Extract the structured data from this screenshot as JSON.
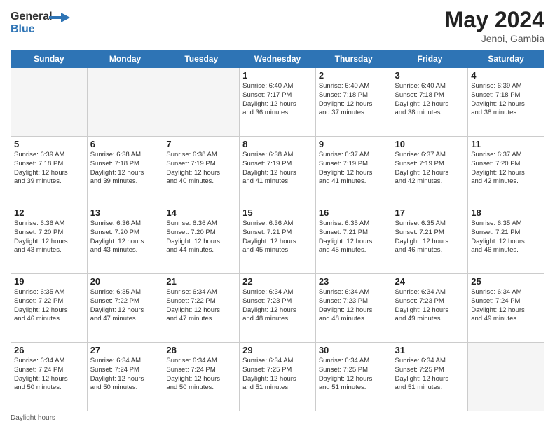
{
  "logo": {
    "line1": "General",
    "line2": "Blue"
  },
  "title": "May 2024",
  "subtitle": "Jenoi, Gambia",
  "days_of_week": [
    "Sunday",
    "Monday",
    "Tuesday",
    "Wednesday",
    "Thursday",
    "Friday",
    "Saturday"
  ],
  "weeks": [
    [
      {
        "day": "",
        "info": ""
      },
      {
        "day": "",
        "info": ""
      },
      {
        "day": "",
        "info": ""
      },
      {
        "day": "1",
        "info": "Sunrise: 6:40 AM\nSunset: 7:17 PM\nDaylight: 12 hours\nand 36 minutes."
      },
      {
        "day": "2",
        "info": "Sunrise: 6:40 AM\nSunset: 7:18 PM\nDaylight: 12 hours\nand 37 minutes."
      },
      {
        "day": "3",
        "info": "Sunrise: 6:40 AM\nSunset: 7:18 PM\nDaylight: 12 hours\nand 38 minutes."
      },
      {
        "day": "4",
        "info": "Sunrise: 6:39 AM\nSunset: 7:18 PM\nDaylight: 12 hours\nand 38 minutes."
      }
    ],
    [
      {
        "day": "5",
        "info": "Sunrise: 6:39 AM\nSunset: 7:18 PM\nDaylight: 12 hours\nand 39 minutes."
      },
      {
        "day": "6",
        "info": "Sunrise: 6:38 AM\nSunset: 7:18 PM\nDaylight: 12 hours\nand 39 minutes."
      },
      {
        "day": "7",
        "info": "Sunrise: 6:38 AM\nSunset: 7:19 PM\nDaylight: 12 hours\nand 40 minutes."
      },
      {
        "day": "8",
        "info": "Sunrise: 6:38 AM\nSunset: 7:19 PM\nDaylight: 12 hours\nand 41 minutes."
      },
      {
        "day": "9",
        "info": "Sunrise: 6:37 AM\nSunset: 7:19 PM\nDaylight: 12 hours\nand 41 minutes."
      },
      {
        "day": "10",
        "info": "Sunrise: 6:37 AM\nSunset: 7:19 PM\nDaylight: 12 hours\nand 42 minutes."
      },
      {
        "day": "11",
        "info": "Sunrise: 6:37 AM\nSunset: 7:20 PM\nDaylight: 12 hours\nand 42 minutes."
      }
    ],
    [
      {
        "day": "12",
        "info": "Sunrise: 6:36 AM\nSunset: 7:20 PM\nDaylight: 12 hours\nand 43 minutes."
      },
      {
        "day": "13",
        "info": "Sunrise: 6:36 AM\nSunset: 7:20 PM\nDaylight: 12 hours\nand 43 minutes."
      },
      {
        "day": "14",
        "info": "Sunrise: 6:36 AM\nSunset: 7:20 PM\nDaylight: 12 hours\nand 44 minutes."
      },
      {
        "day": "15",
        "info": "Sunrise: 6:36 AM\nSunset: 7:21 PM\nDaylight: 12 hours\nand 45 minutes."
      },
      {
        "day": "16",
        "info": "Sunrise: 6:35 AM\nSunset: 7:21 PM\nDaylight: 12 hours\nand 45 minutes."
      },
      {
        "day": "17",
        "info": "Sunrise: 6:35 AM\nSunset: 7:21 PM\nDaylight: 12 hours\nand 46 minutes."
      },
      {
        "day": "18",
        "info": "Sunrise: 6:35 AM\nSunset: 7:21 PM\nDaylight: 12 hours\nand 46 minutes."
      }
    ],
    [
      {
        "day": "19",
        "info": "Sunrise: 6:35 AM\nSunset: 7:22 PM\nDaylight: 12 hours\nand 46 minutes."
      },
      {
        "day": "20",
        "info": "Sunrise: 6:35 AM\nSunset: 7:22 PM\nDaylight: 12 hours\nand 47 minutes."
      },
      {
        "day": "21",
        "info": "Sunrise: 6:34 AM\nSunset: 7:22 PM\nDaylight: 12 hours\nand 47 minutes."
      },
      {
        "day": "22",
        "info": "Sunrise: 6:34 AM\nSunset: 7:23 PM\nDaylight: 12 hours\nand 48 minutes."
      },
      {
        "day": "23",
        "info": "Sunrise: 6:34 AM\nSunset: 7:23 PM\nDaylight: 12 hours\nand 48 minutes."
      },
      {
        "day": "24",
        "info": "Sunrise: 6:34 AM\nSunset: 7:23 PM\nDaylight: 12 hours\nand 49 minutes."
      },
      {
        "day": "25",
        "info": "Sunrise: 6:34 AM\nSunset: 7:24 PM\nDaylight: 12 hours\nand 49 minutes."
      }
    ],
    [
      {
        "day": "26",
        "info": "Sunrise: 6:34 AM\nSunset: 7:24 PM\nDaylight: 12 hours\nand 50 minutes."
      },
      {
        "day": "27",
        "info": "Sunrise: 6:34 AM\nSunset: 7:24 PM\nDaylight: 12 hours\nand 50 minutes."
      },
      {
        "day": "28",
        "info": "Sunrise: 6:34 AM\nSunset: 7:24 PM\nDaylight: 12 hours\nand 50 minutes."
      },
      {
        "day": "29",
        "info": "Sunrise: 6:34 AM\nSunset: 7:25 PM\nDaylight: 12 hours\nand 51 minutes."
      },
      {
        "day": "30",
        "info": "Sunrise: 6:34 AM\nSunset: 7:25 PM\nDaylight: 12 hours\nand 51 minutes."
      },
      {
        "day": "31",
        "info": "Sunrise: 6:34 AM\nSunset: 7:25 PM\nDaylight: 12 hours\nand 51 minutes."
      },
      {
        "day": "",
        "info": ""
      }
    ]
  ],
  "footer": "Daylight hours"
}
